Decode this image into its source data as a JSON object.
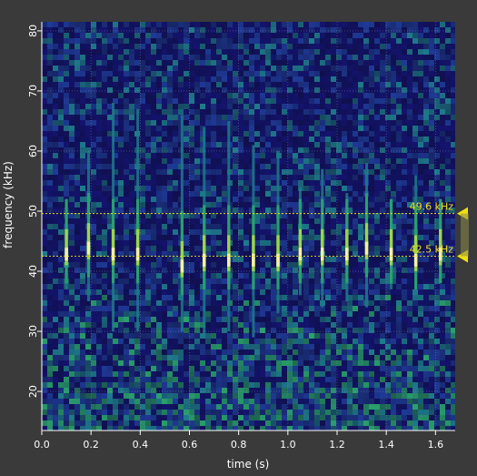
{
  "chart_data": {
    "type": "heatmap",
    "xlabel": "time (s)",
    "ylabel": "frequency (kHz)",
    "xlim": [
      0.0,
      1.68
    ],
    "ylim": [
      13.5,
      81.5
    ],
    "x_ticks": [
      0.0,
      0.2,
      0.4,
      0.6,
      0.8,
      1.0,
      1.2,
      1.4,
      1.6
    ],
    "x_tick_labels": [
      "0.0",
      "0.2",
      "0.4",
      "0.6",
      "0.8",
      "1.0",
      "1.2",
      "1.4",
      "1.6"
    ],
    "y_ticks": [
      20,
      30,
      40,
      50,
      60,
      70,
      80
    ],
    "y_tick_labels": [
      "20",
      "30",
      "40",
      "50",
      "60",
      "70",
      "80"
    ],
    "grid": true,
    "colormap": [
      "#14146e",
      "#1f3a96",
      "#1f7a8c",
      "#2aa06e",
      "#9ad64a",
      "#f2f2a0"
    ],
    "background_color": "#3a3a3a",
    "annotation_color": "#f0e010",
    "markers": [
      {
        "label": "49.6 kHz",
        "freq_khz": 49.6
      },
      {
        "label": "42.5 kHz",
        "freq_khz": 42.5
      }
    ],
    "calls": [
      {
        "time_s": 0.1,
        "low_khz": 37,
        "high_khz": 52,
        "peak_khz": 43
      },
      {
        "time_s": 0.19,
        "low_khz": 35,
        "high_khz": 60,
        "peak_khz": 44
      },
      {
        "time_s": 0.29,
        "low_khz": 30,
        "high_khz": 68,
        "peak_khz": 43
      },
      {
        "time_s": 0.39,
        "low_khz": 30,
        "high_khz": 67,
        "peak_khz": 43
      },
      {
        "time_s": 0.57,
        "low_khz": 30,
        "high_khz": 66,
        "peak_khz": 41
      },
      {
        "time_s": 0.66,
        "low_khz": 29,
        "high_khz": 64,
        "peak_khz": 42
      },
      {
        "time_s": 0.76,
        "low_khz": 30,
        "high_khz": 65,
        "peak_khz": 42
      },
      {
        "time_s": 0.86,
        "low_khz": 29,
        "high_khz": 61,
        "peak_khz": 42
      },
      {
        "time_s": 0.96,
        "low_khz": 33,
        "high_khz": 60,
        "peak_khz": 42
      },
      {
        "time_s": 1.05,
        "low_khz": 36,
        "high_khz": 54,
        "peak_khz": 43
      },
      {
        "time_s": 1.14,
        "low_khz": 34,
        "high_khz": 57,
        "peak_khz": 43
      },
      {
        "time_s": 1.24,
        "low_khz": 35,
        "high_khz": 53,
        "peak_khz": 43
      },
      {
        "time_s": 1.32,
        "low_khz": 34,
        "high_khz": 58,
        "peak_khz": 44
      },
      {
        "time_s": 1.42,
        "low_khz": 37,
        "high_khz": 52,
        "peak_khz": 43
      },
      {
        "time_s": 1.52,
        "low_khz": 36,
        "high_khz": 56,
        "peak_khz": 42
      },
      {
        "time_s": 1.62,
        "low_khz": 38,
        "high_khz": 47,
        "peak_khz": 43
      }
    ]
  }
}
